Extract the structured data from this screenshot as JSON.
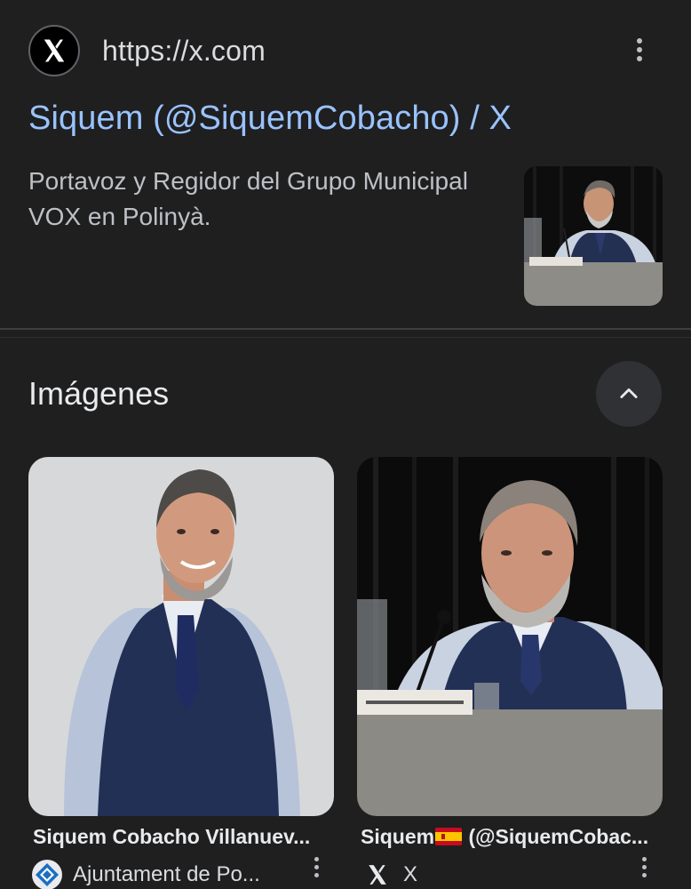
{
  "result": {
    "site_url": "https://x.com",
    "favicon_icon": "x-logo-icon",
    "title": "Siquem (@SiquemCobacho) / X",
    "snippet": "Portavoz y Regidor del Grupo Municipal VOX en Polinyà.",
    "more_icon": "more-vert-icon",
    "thumbnail_icon": "man-at-desk-photo"
  },
  "images_section": {
    "title": "Imágenes",
    "collapse_icon": "chevron-up-icon",
    "items": [
      {
        "caption": "Siquem Cobacho Villanuev...",
        "source": "Ajuntament de Po...",
        "source_icon": "ajuntament-logo-icon"
      },
      {
        "caption_prefix": "Siquem",
        "caption_flag": "spain-flag-icon",
        "caption_suffix": " (@SiquemCobac...",
        "source": "X",
        "source_icon": "x-logo-icon"
      }
    ]
  },
  "colors": {
    "background": "#1f1f1f",
    "link": "#99c3ff",
    "text_primary": "#e8eaed",
    "text_secondary": "#bdc1c6"
  }
}
